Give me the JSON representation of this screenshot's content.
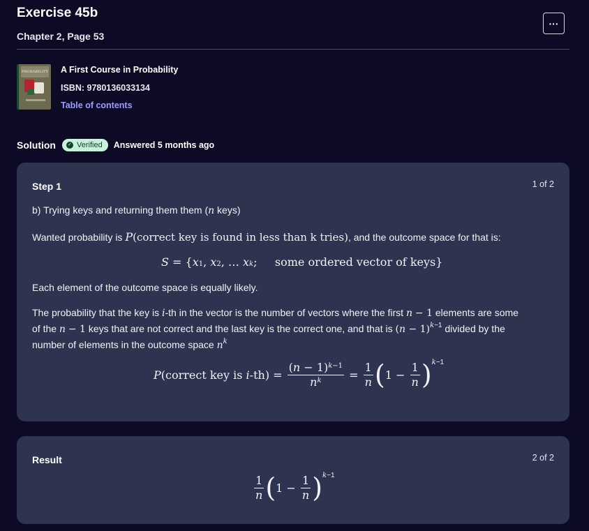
{
  "header": {
    "title": "Exercise 45b",
    "subtitle": "Chapter 2, Page 53",
    "more_label": "···"
  },
  "book": {
    "cover_title": "PROBABILITY",
    "title": "A First Course in Probability",
    "isbn": "ISBN: 9780136033134",
    "toc_link": "Table of contents"
  },
  "solution": {
    "label": "Solution",
    "badge": "Verified",
    "answered": "Answered 5 months ago"
  },
  "step1": {
    "title": "Step 1",
    "count": "1 of 2",
    "line1": "b) Trying keys and returning them them (n keys)",
    "line2_pre": "Wanted probability is ",
    "line2_math": "P(correct key is found in less than k tries)",
    "line2_post": ", and the outcome space for that is:",
    "eq1": "S = {x₁, x₂, … x_k;     some ordered vector of keys}",
    "line3": "Each element of the outcome space is equally likely.",
    "line4": "The probability that the key is i-th in the vector is the number of vectors where the first n − 1 elements are some",
    "line5": "of the n − 1 keys that are not correct and the last key is the correct one, and that is (n − 1)^(k−1) divided by the",
    "line6": "number of elements in the outcome space n^k",
    "eq2_lhs": "P(correct key is i-th) ="
  },
  "result": {
    "title": "Result",
    "count": "2 of 2"
  },
  "colors": {
    "background": "#0c0a24",
    "card": "#2e3350",
    "link": "#9f9cff",
    "badge_bg": "#c8f1dc",
    "badge_fg": "#12422c"
  }
}
